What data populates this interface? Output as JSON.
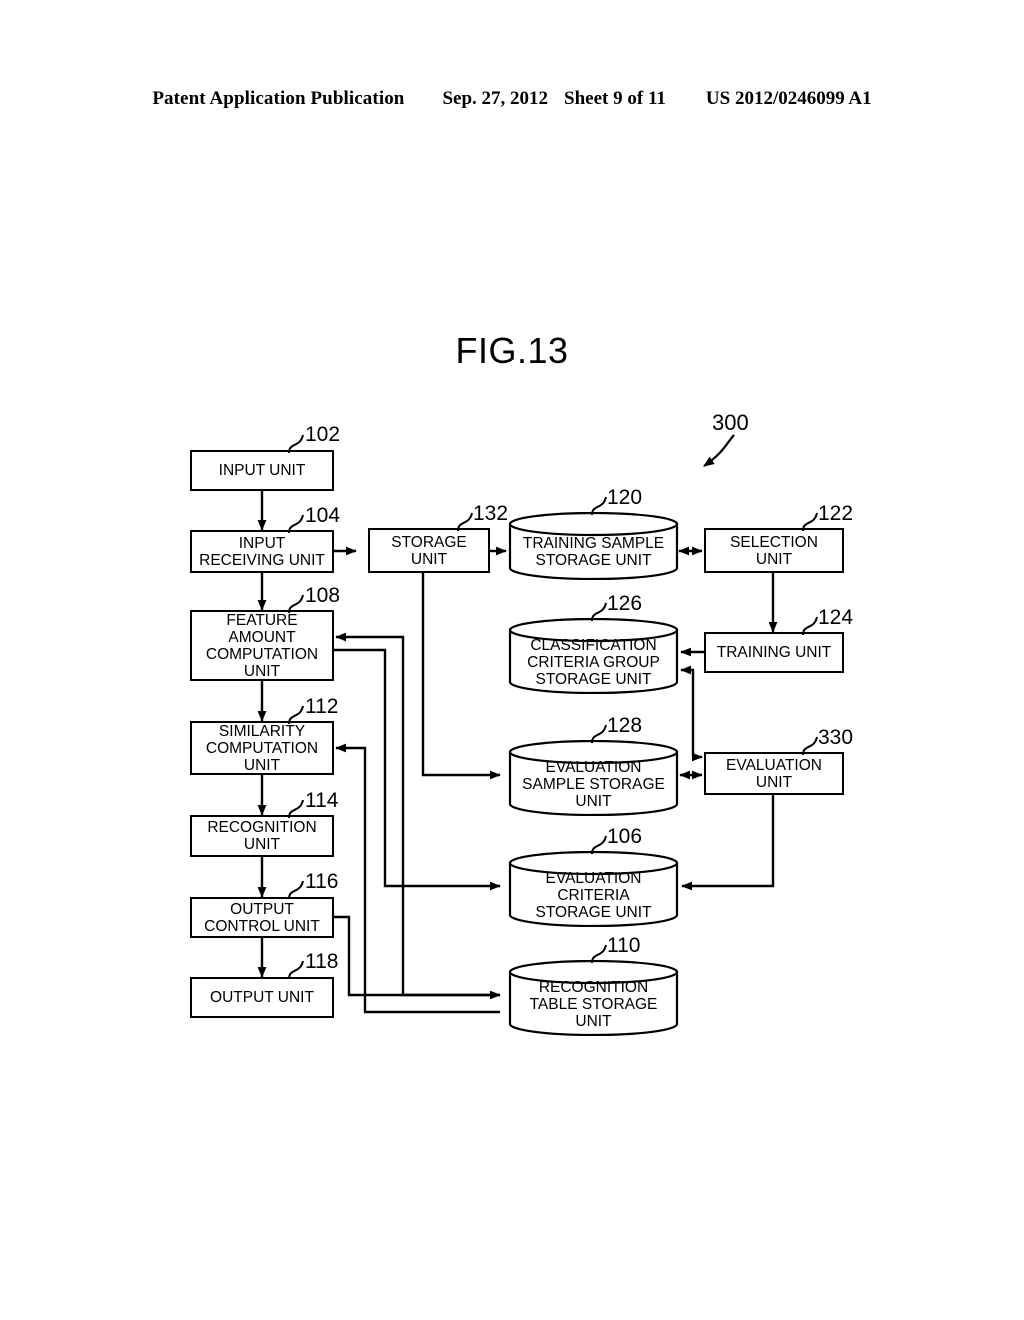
{
  "header": {
    "publication": "Patent Application Publication",
    "date": "Sep. 27, 2012",
    "sheet": "Sheet 9 of 11",
    "docnum": "US 2012/0246099 A1"
  },
  "figure": {
    "title": "FIG.13",
    "system_ref": "300"
  },
  "nodes": [
    {
      "id": "input_unit",
      "ref": "102",
      "label": "INPUT UNIT",
      "shape": "box"
    },
    {
      "id": "input_receiving_unit",
      "ref": "104",
      "label": "INPUT\nRECEIVING UNIT",
      "shape": "box"
    },
    {
      "id": "feature_amount_unit",
      "ref": "108",
      "label": "FEATURE\nAMOUNT\nCOMPUTATION\nUNIT",
      "shape": "box"
    },
    {
      "id": "similarity_unit",
      "ref": "112",
      "label": "SIMILARITY\nCOMPUTATION\nUNIT",
      "shape": "box"
    },
    {
      "id": "recognition_unit",
      "ref": "114",
      "label": "RECOGNITION\nUNIT",
      "shape": "box"
    },
    {
      "id": "output_control_unit",
      "ref": "116",
      "label": "OUTPUT\nCONTROL UNIT",
      "shape": "box"
    },
    {
      "id": "output_unit",
      "ref": "118",
      "label": "OUTPUT UNIT",
      "shape": "box"
    },
    {
      "id": "storage_unit",
      "ref": "132",
      "label": "STORAGE\nUNIT",
      "shape": "box"
    },
    {
      "id": "training_sample_store",
      "ref": "120",
      "label": "TRAINING SAMPLE\nSTORAGE UNIT",
      "shape": "cylinder"
    },
    {
      "id": "classification_store",
      "ref": "126",
      "label": "CLASSIFICATION\nCRITERIA GROUP\nSTORAGE UNIT",
      "shape": "cylinder"
    },
    {
      "id": "evaluation_sample_store",
      "ref": "128",
      "label": "EVALUATION\nSAMPLE STORAGE\nUNIT",
      "shape": "cylinder"
    },
    {
      "id": "evaluation_criteria_store",
      "ref": "106",
      "label": "EVALUATION\nCRITERIA\nSTORAGE UNIT",
      "shape": "cylinder"
    },
    {
      "id": "recognition_table_store",
      "ref": "110",
      "label": "RECOGNITION\nTABLE STORAGE\nUNIT",
      "shape": "cylinder"
    },
    {
      "id": "selection_unit",
      "ref": "122",
      "label": "SELECTION\nUNIT",
      "shape": "box"
    },
    {
      "id": "training_unit",
      "ref": "124",
      "label": "TRAINING UNIT",
      "shape": "box"
    },
    {
      "id": "evaluation_unit",
      "ref": "330",
      "label": "EVALUATION\nUNIT",
      "shape": "box"
    }
  ],
  "connections": [
    {
      "from": "input_unit",
      "to": "input_receiving_unit",
      "arrow": "single"
    },
    {
      "from": "input_receiving_unit",
      "to": "feature_amount_unit",
      "arrow": "single"
    },
    {
      "from": "input_receiving_unit",
      "to": "storage_unit",
      "arrow": "single"
    },
    {
      "from": "storage_unit",
      "to": "training_sample_store",
      "arrow": "single"
    },
    {
      "from": "storage_unit",
      "to": "evaluation_sample_store",
      "arrow": "single"
    },
    {
      "from": "training_sample_store",
      "to": "selection_unit",
      "arrow": "double"
    },
    {
      "from": "selection_unit",
      "to": "training_unit",
      "arrow": "single"
    },
    {
      "from": "training_unit",
      "to": "classification_store",
      "arrow": "single"
    },
    {
      "from": "classification_store",
      "to": "evaluation_unit",
      "arrow": "single"
    },
    {
      "from": "evaluation_sample_store",
      "to": "evaluation_unit",
      "arrow": "double"
    },
    {
      "from": "evaluation_unit",
      "to": "evaluation_criteria_store",
      "arrow": "single"
    },
    {
      "from": "feature_amount_unit",
      "to": "similarity_unit",
      "arrow": "single"
    },
    {
      "from": "feature_amount_unit",
      "to": "evaluation_criteria_store",
      "arrow": "single"
    },
    {
      "from": "similarity_unit",
      "to": "recognition_unit",
      "arrow": "single"
    },
    {
      "from": "recognition_unit",
      "to": "output_control_unit",
      "arrow": "single"
    },
    {
      "from": "output_control_unit",
      "to": "output_unit",
      "arrow": "single"
    },
    {
      "from": "recognition_table_store",
      "to": "feature_amount_unit",
      "arrow": "single"
    },
    {
      "from": "recognition_table_store",
      "to": "similarity_unit",
      "arrow": "single"
    },
    {
      "from": "output_control_unit",
      "to": "recognition_table_store",
      "arrow": "single"
    },
    {
      "from": "similarity_unit",
      "to": "recognition_table_store",
      "arrow": "single"
    }
  ]
}
